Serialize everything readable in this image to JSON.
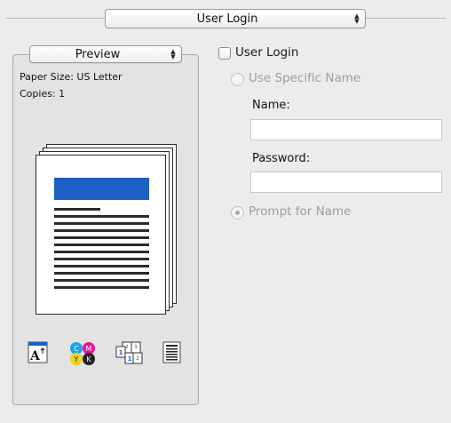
{
  "top_popup": {
    "label": "User Login",
    "arrows": "▲▼"
  },
  "preview": {
    "popup_label": "Preview",
    "paper_size": "Paper Size: US Letter",
    "copies": "Copies: 1",
    "accent_color": "#1d5fc3",
    "icons": [
      {
        "name": "orientation-icon",
        "text": "A"
      },
      {
        "name": "color-cmyk-icon",
        "letters": [
          "C",
          "M",
          "Y",
          "K"
        ],
        "colors": [
          "#1aa6e6",
          "#e6169b",
          "#f2d21b",
          "#222222"
        ]
      },
      {
        "name": "multiple-pages-icon",
        "text": "1 2 3"
      },
      {
        "name": "page-layout-icon",
        "text": ""
      }
    ]
  },
  "user_login": {
    "checkbox_label": "User Login",
    "checked": false,
    "use_specific_name_label": "Use Specific Name",
    "name_label": "Name:",
    "name_value": "",
    "password_label": "Password:",
    "password_value": "",
    "prompt_for_name_label": "Prompt for Name",
    "selected_option": "Prompt for Name"
  }
}
